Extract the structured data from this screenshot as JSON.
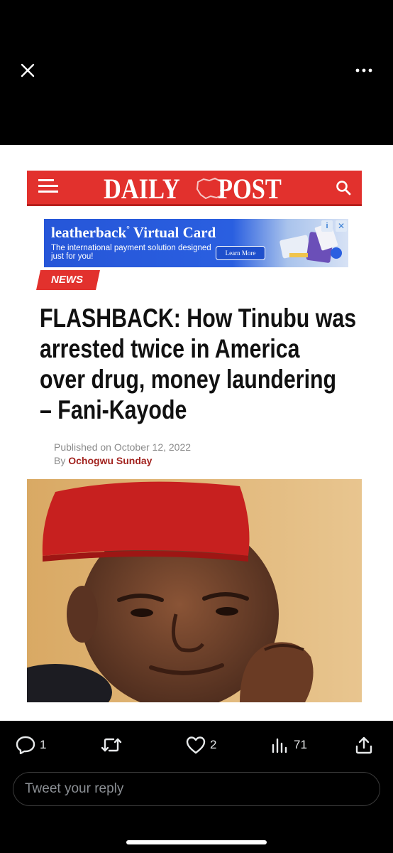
{
  "viewer": {
    "close_icon": "close-icon",
    "more_icon": "more-horizontal-icon"
  },
  "article": {
    "masthead": {
      "left": "DAILY",
      "right": "POST",
      "brand_color": "#e2312d"
    },
    "ad": {
      "brand": "leatherback",
      "brand_mark": "°",
      "product": "Virtual Card",
      "description": "The international payment solution designed just for you!",
      "cta": "Learn More",
      "info": "i",
      "close": "✕"
    },
    "category": "NEWS",
    "headline_lines": [
      "FLASHBACK: How Tinubu was",
      "arrested twice in America",
      "over drug, money laundering",
      "– Fani-Kayode"
    ],
    "published_label": "Published on",
    "published_date": "October 12, 2022",
    "by_label": "By",
    "author": "Ochogwu Sunday"
  },
  "tweet_actions": {
    "replies": "1",
    "retweets": "",
    "likes": "2",
    "views": "71"
  },
  "reply_box": {
    "placeholder": "Tweet your reply"
  }
}
